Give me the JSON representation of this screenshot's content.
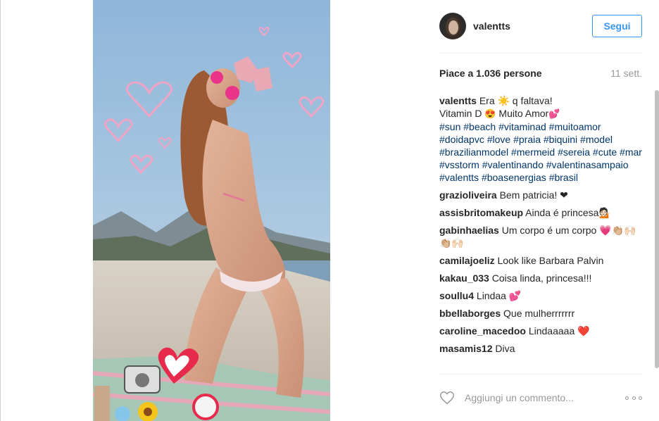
{
  "post": {
    "username": "valentts",
    "follow_label": "Segui",
    "likes": "Piace a 1.036 persone",
    "time": "11 sett."
  },
  "caption": {
    "username": "valentts",
    "line1": "Era ☀️ q faltava!",
    "line2_a": "Vitamin D",
    "line2_emoji": "😍",
    "line2_b": "Muito Amor",
    "line2_emoji2": "💕",
    "hashtags": [
      "#sun",
      "#beach",
      "#vitaminad",
      "#muitoamor",
      "#doidapvc",
      "#love",
      "#praia",
      "#biquini",
      "#model",
      "#brazilianmodel",
      "#mermeid",
      "#sereia",
      "#cute",
      "#mar",
      "#vsstorm",
      "#valentinando",
      "#valentinasampaio",
      "#valentts",
      "#boasenergias",
      "#brasil"
    ]
  },
  "comments": [
    {
      "user": "grazioliveira",
      "text": "Bem patricia! ❤"
    },
    {
      "user": "assisbritomakeup",
      "text": "Ainda é princesa💁🏻"
    },
    {
      "user": "gabinhaelias",
      "text": "Um corpo é um corpo 💗👏🏼🙌🏻👏🏼🙌🏻"
    },
    {
      "user": "camilajoeliz",
      "text": "Look like Barbara Palvin"
    },
    {
      "user": "kakau_033",
      "text": "Coisa linda, princesa!!!"
    },
    {
      "user": "soullu4",
      "text": "Lindaa 💕"
    },
    {
      "user": "bbellaborges",
      "text": "Que mulherrrrrrr"
    },
    {
      "user": "caroline_macedoo",
      "text": "Lindaaaaa ❤️"
    },
    {
      "user": "masamis12",
      "text": "Diva"
    }
  ],
  "add_comment": {
    "placeholder": "Aggiungi un commento..."
  },
  "icons": {
    "like": "heart-outline-icon",
    "more": "more-options-icon"
  },
  "colors": {
    "link_blue": "#3897f0",
    "hashtag": "#003569",
    "muted": "#999999"
  }
}
